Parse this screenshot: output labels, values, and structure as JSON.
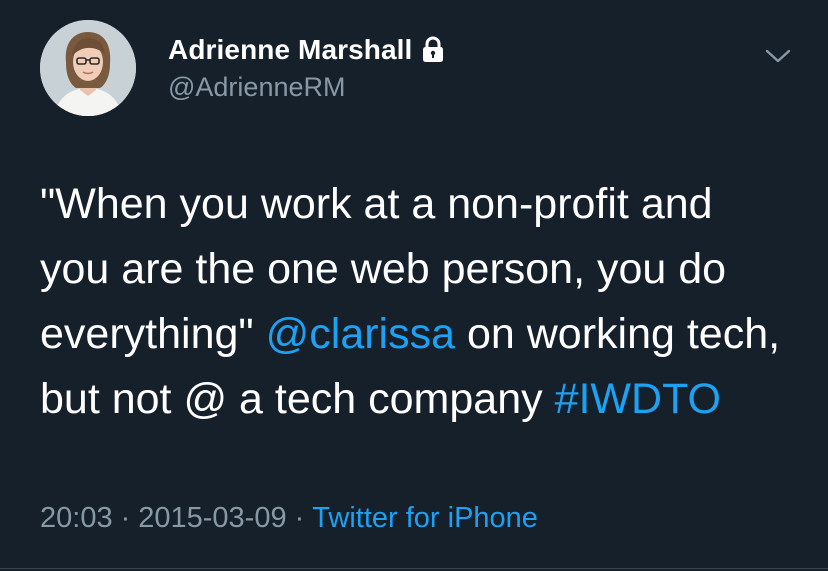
{
  "author": {
    "display_name": "Adrienne Marshall",
    "handle": "@AdrienneRM",
    "protected_icon": "lock-icon",
    "avatar_icon": "profile-photo"
  },
  "menu": {
    "icon": "chevron-down-icon"
  },
  "tweet": {
    "line1": "\"When you work at a non-profit and",
    "line2": "you are the one web person, you do",
    "line3_pre": "everything\" ",
    "line3_mention": "@clarissa",
    "line3_post": " on working tech,",
    "line4_pre": "but not @ a tech company ",
    "line4_hashtag": "#IWDTO"
  },
  "meta": {
    "time": "20:03",
    "separator": "·",
    "date": "2015-03-09",
    "source": "Twitter for iPhone"
  },
  "colors": {
    "background": "#15202b",
    "text": "#ffffff",
    "secondary": "#8899a6",
    "link": "#1da1f2"
  }
}
